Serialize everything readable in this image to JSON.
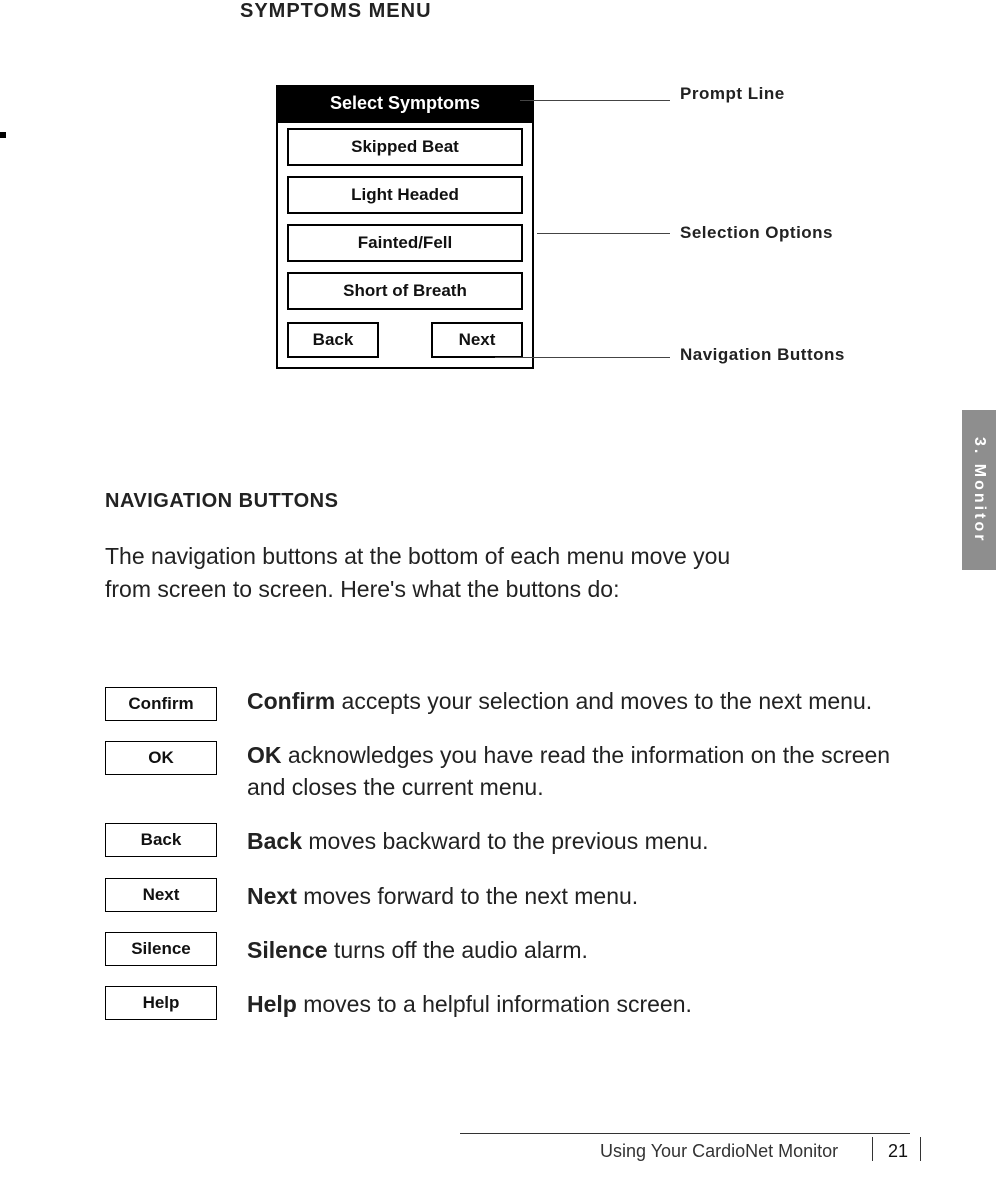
{
  "heading_top": "SYMPTOMS  MENU",
  "device": {
    "prompt": "Select Symptoms",
    "options": [
      "Skipped Beat",
      "Light Headed",
      "Fainted/Fell",
      "Short of Breath"
    ],
    "nav": {
      "back": "Back",
      "next": "Next"
    }
  },
  "callouts": {
    "prompt": "Prompt Line",
    "selection": "Selection Options",
    "navigation": "Navigation Buttons"
  },
  "side_tab": "3.  Monitor",
  "nav_section_heading": "NAVIGATION BUTTONS",
  "intro": "The navigation buttons at the bottom of each menu move you from screen to screen. Here's what the buttons do:",
  "defs": [
    {
      "label": "Confirm",
      "bold": "Confirm",
      "rest": " accepts your selection and moves to the next menu."
    },
    {
      "label": "OK",
      "bold": "OK",
      "rest": " acknowledges you have read the information on the screen and closes the current menu."
    },
    {
      "label": "Back",
      "bold": "Back",
      "rest": " moves backward to the previous menu."
    },
    {
      "label": "Next",
      "bold": "Next ",
      "rest": " moves forward to the next menu."
    },
    {
      "label": "Silence",
      "bold": "Silence",
      "rest": " turns off the audio alarm."
    },
    {
      "label": "Help",
      "bold": "Help",
      "rest": " moves to a helpful information screen."
    }
  ],
  "footer": {
    "text": "Using Your CardioNet Monitor",
    "page": "21"
  }
}
